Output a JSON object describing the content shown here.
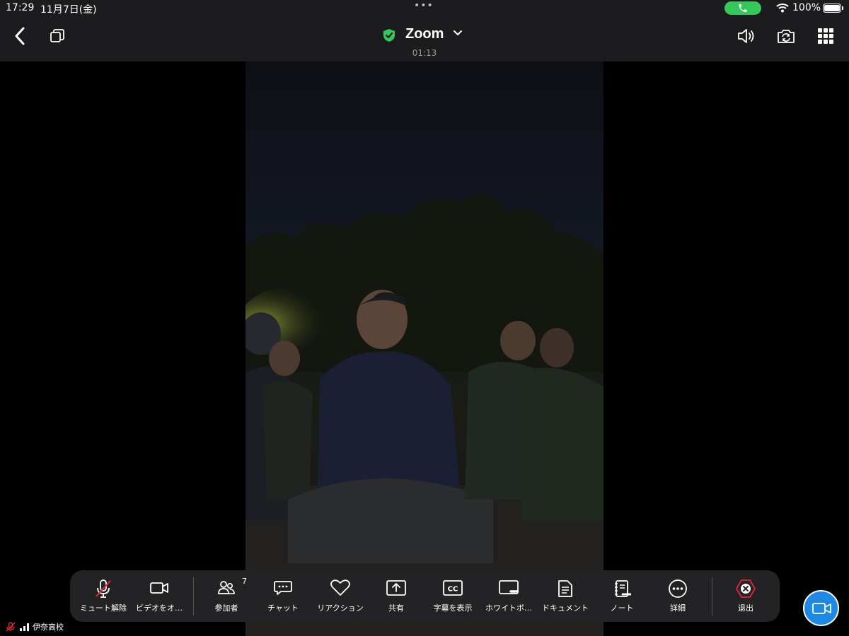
{
  "status_bar": {
    "time": "17:29",
    "date": "11月7日(金)",
    "multitask_dots": "•••",
    "battery": "100%",
    "call_color": "#34c759"
  },
  "header": {
    "title": "Zoom",
    "timer": "01:13",
    "shield_color": "#34c759"
  },
  "icons": {
    "back": "chevron-left-icon",
    "copy": "copy-window-icon",
    "speaker": "speaker-icon",
    "camera_switch": "camera-switch-icon",
    "grid": "grid-icon"
  },
  "video": {
    "pager": {
      "pages": 2,
      "active": 1
    }
  },
  "toolbar": {
    "items": [
      {
        "label": "ミュート解除",
        "icon": "mic-muted-icon"
      },
      {
        "label": "ビデオをオ…",
        "icon": "video-camera-icon"
      },
      {
        "label": "参加者",
        "icon": "participants-icon",
        "badge": "7"
      },
      {
        "label": "チャット",
        "icon": "chat-icon"
      },
      {
        "label": "リアクション",
        "icon": "heart-icon"
      },
      {
        "label": "共有",
        "icon": "share-icon"
      },
      {
        "label": "字幕を表示",
        "icon": "captions-icon"
      },
      {
        "label": "ホワイトボ…",
        "icon": "whiteboard-icon"
      },
      {
        "label": "ドキュメント",
        "icon": "document-icon"
      },
      {
        "label": "ノート",
        "icon": "notes-icon"
      },
      {
        "label": "詳細",
        "icon": "more-icon"
      },
      {
        "label": "退出",
        "icon": "leave-icon"
      }
    ],
    "accent": "#e0263f"
  },
  "participant": {
    "name": "伊奈高校"
  },
  "floating_button": {
    "icon": "video-camera-icon",
    "color": "#1e88e5"
  }
}
